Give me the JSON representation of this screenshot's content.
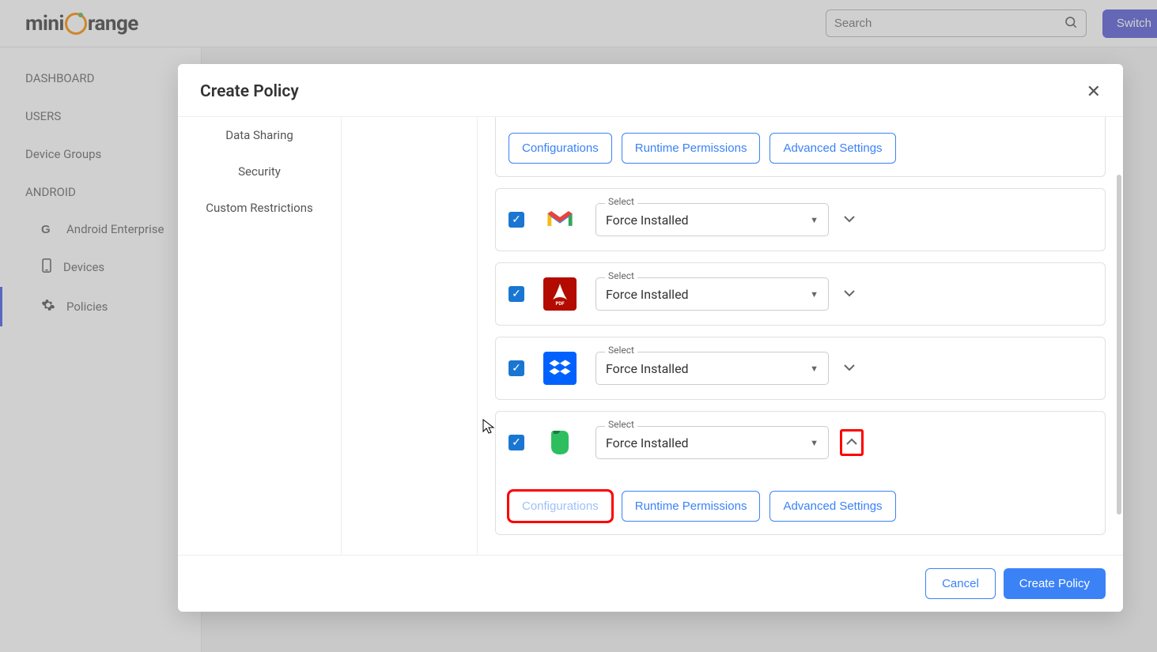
{
  "header": {
    "logo_pre": "mini",
    "logo_post": "range",
    "search_placeholder": "Search",
    "switch_label": "Switch"
  },
  "sidebar": {
    "items": [
      {
        "label": "DASHBOARD"
      },
      {
        "label": "USERS"
      },
      {
        "label": "Device Groups"
      },
      {
        "label": "ANDROID"
      }
    ],
    "android_sub": [
      {
        "label": "Android Enterprise"
      },
      {
        "label": "Devices"
      },
      {
        "label": "Policies"
      }
    ]
  },
  "modal": {
    "title": "Create Policy",
    "left_tabs": [
      {
        "label": "Data Sharing"
      },
      {
        "label": "Security"
      },
      {
        "label": "Custom Restrictions"
      }
    ],
    "tab_labels": {
      "config": "Configurations",
      "runtime": "Runtime Permissions",
      "advanced": "Advanced Settings"
    },
    "select_label": "Select",
    "apps": [
      {
        "name": "gmail",
        "select_value": "Force Installed",
        "checked": true,
        "expanded": false
      },
      {
        "name": "adobe",
        "select_value": "Force Installed",
        "checked": true,
        "expanded": false
      },
      {
        "name": "dropbox",
        "select_value": "Force Installed",
        "checked": true,
        "expanded": false
      },
      {
        "name": "evernote",
        "select_value": "Force Installed",
        "checked": true,
        "expanded": true
      }
    ],
    "footer": {
      "cancel": "Cancel",
      "create": "Create Policy"
    }
  }
}
